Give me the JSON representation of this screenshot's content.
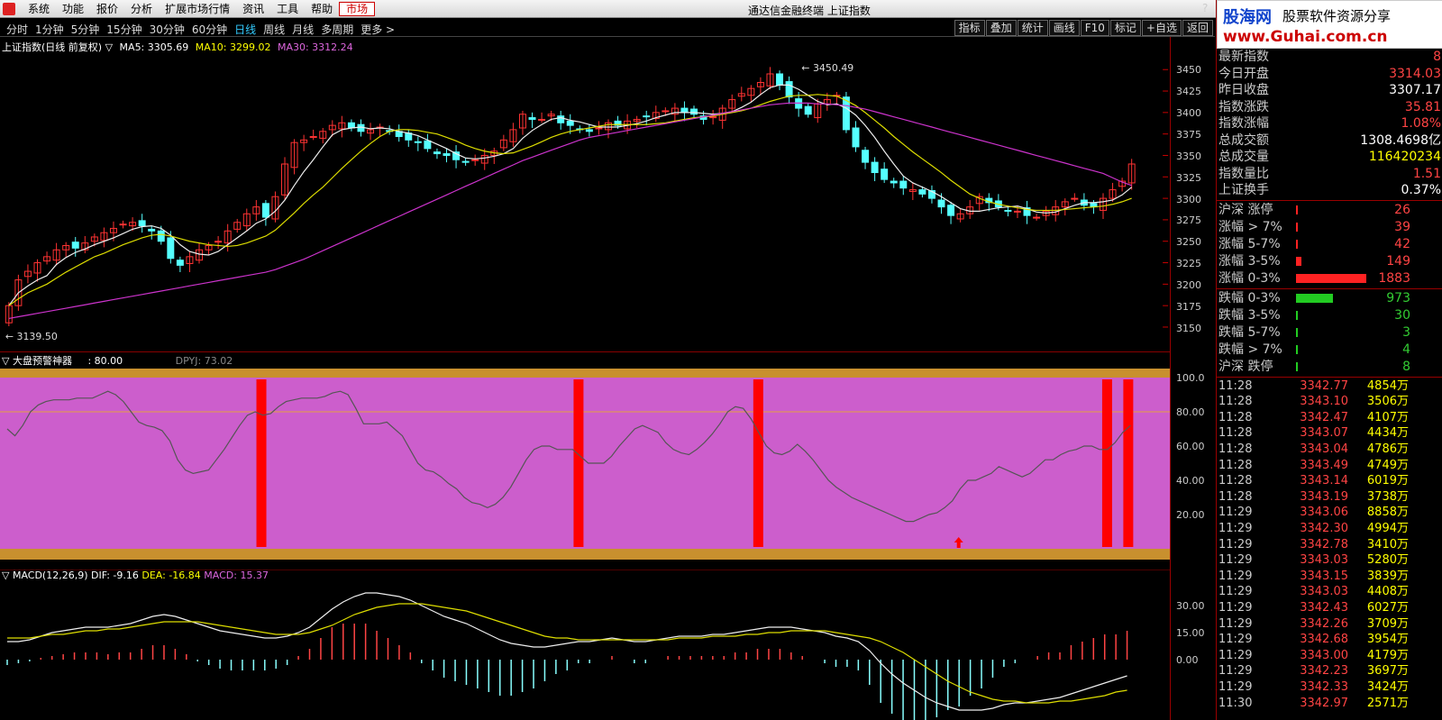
{
  "menu": {
    "items": [
      "系统",
      "功能",
      "报价",
      "分析",
      "扩展市场行情",
      "资讯",
      "工具",
      "帮助",
      "市场"
    ],
    "active_index": 8
  },
  "window_title": "通达信金融终端  上证指数",
  "periods": {
    "tabs": [
      "分时",
      "1分钟",
      "5分钟",
      "15分钟",
      "30分钟",
      "60分钟",
      "日线",
      "周线",
      "月线",
      "多周期",
      "更多 >"
    ],
    "selected_index": 6
  },
  "toolbar_right": [
    "指标",
    "叠加",
    "统计",
    "画线",
    "F10",
    "标记",
    "+自选",
    "返回"
  ],
  "help_label": "?",
  "legend": {
    "title": "上证指数(日线 前复权) ▽",
    "ma5": "MA5: 3305.69",
    "ma10": "MA10: 3299.02",
    "ma30": "MA30: 3312.24"
  },
  "price_annotations": {
    "high": "3450.49",
    "low": "3139.50"
  },
  "axis": {
    "price_ticks": [
      "3450",
      "3425",
      "3400",
      "3375",
      "3350",
      "3325",
      "3300",
      "3275",
      "3250",
      "3225",
      "3200",
      "3175",
      "3150"
    ],
    "ind_ticks": [
      "100.0",
      "80.00",
      "60.00",
      "40.00",
      "20.00"
    ],
    "macd_ticks": [
      "30.00",
      "15.00",
      "0.00"
    ]
  },
  "indicator": {
    "name": "▽ 大盘预警神器",
    "value": ": 80.00",
    "dpyj": "DPYJ: 73.02"
  },
  "macd": {
    "name": "▽ MACD(12,26,9)",
    "dif": "DIF: -9.16",
    "dea": "DEA: -16.84",
    "macd": "MACD: 15.37"
  },
  "logo": {
    "main": "股海网",
    "sub": "股票软件资源分享",
    "url": "www.Guhai.com.cn"
  },
  "quote": [
    {
      "k": "最新指数",
      "v": "8",
      "c": "red"
    },
    {
      "k": "今日开盘",
      "v": "3314.03",
      "c": "red"
    },
    {
      "k": "昨日收盘",
      "v": "3307.17",
      "c": "wht"
    },
    {
      "k": "指数涨跌",
      "v": "35.81",
      "c": "red"
    },
    {
      "k": "指数涨幅",
      "v": "1.08%",
      "c": "red"
    },
    {
      "k": "总成交额",
      "v": "1308.4698亿",
      "c": "wht"
    },
    {
      "k": "总成交量",
      "v": "116420234",
      "c": "yel"
    },
    {
      "k": "指数量比",
      "v": "1.51",
      "c": "red"
    },
    {
      "k": "上证换手",
      "v": "0.37%",
      "c": "wht"
    }
  ],
  "breadth_up": [
    {
      "k": "沪深  涨停",
      "v": "26",
      "frac": 0.0
    },
    {
      "k": "涨幅 > 7%",
      "v": "39",
      "frac": 0.0
    },
    {
      "k": "涨幅 5-7%",
      "v": "42",
      "frac": 0.0
    },
    {
      "k": "涨幅 3-5%",
      "v": "149",
      "frac": 0.08
    },
    {
      "k": "涨幅 0-3%",
      "v": "1883",
      "frac": 1.0
    }
  ],
  "breadth_down": [
    {
      "k": "跌幅 0-3%",
      "v": "973",
      "frac": 0.52
    },
    {
      "k": "跌幅 3-5%",
      "v": "30",
      "frac": 0.0
    },
    {
      "k": "跌幅 5-7%",
      "v": "3",
      "frac": 0.0
    },
    {
      "k": "跌幅 > 7%",
      "v": "4",
      "frac": 0.0
    },
    {
      "k": "沪深  跌停",
      "v": "8",
      "frac": 0.0
    }
  ],
  "ticks": [
    {
      "t": "11:28",
      "p": "3342.77",
      "q": "4854万"
    },
    {
      "t": "11:28",
      "p": "3343.10",
      "q": "3506万"
    },
    {
      "t": "11:28",
      "p": "3342.47",
      "q": "4107万"
    },
    {
      "t": "11:28",
      "p": "3343.07",
      "q": "4434万"
    },
    {
      "t": "11:28",
      "p": "3343.04",
      "q": "4786万"
    },
    {
      "t": "11:28",
      "p": "3343.49",
      "q": "4749万"
    },
    {
      "t": "11:28",
      "p": "3343.14",
      "q": "6019万"
    },
    {
      "t": "11:28",
      "p": "3343.19",
      "q": "3738万"
    },
    {
      "t": "11:29",
      "p": "3343.06",
      "q": "8858万"
    },
    {
      "t": "11:29",
      "p": "3342.30",
      "q": "4994万"
    },
    {
      "t": "11:29",
      "p": "3342.78",
      "q": "3410万"
    },
    {
      "t": "11:29",
      "p": "3343.03",
      "q": "5280万"
    },
    {
      "t": "11:29",
      "p": "3343.15",
      "q": "3839万"
    },
    {
      "t": "11:29",
      "p": "3343.03",
      "q": "4408万"
    },
    {
      "t": "11:29",
      "p": "3342.43",
      "q": "6027万"
    },
    {
      "t": "11:29",
      "p": "3342.26",
      "q": "3709万"
    },
    {
      "t": "11:29",
      "p": "3342.68",
      "q": "3954万"
    },
    {
      "t": "11:29",
      "p": "3343.00",
      "q": "4179万"
    },
    {
      "t": "11:29",
      "p": "3342.23",
      "q": "3697万"
    },
    {
      "t": "11:29",
      "p": "3342.33",
      "q": "3424万"
    },
    {
      "t": "11:30",
      "p": "3342.97",
      "q": "2571万"
    }
  ],
  "chart_data": [
    {
      "type": "candlestick",
      "title": "上证指数(日线 前复权)",
      "ylim": [
        3130,
        3465
      ],
      "close": [
        3175,
        3205,
        3215,
        3225,
        3232,
        3240,
        3245,
        3242,
        3248,
        3255,
        3260,
        3265,
        3270,
        3272,
        3268,
        3262,
        3250,
        3230,
        3222,
        3232,
        3240,
        3245,
        3250,
        3262,
        3272,
        3282,
        3290,
        3278,
        3302,
        3340,
        3365,
        3368,
        3372,
        3378,
        3385,
        3388,
        3382,
        3378,
        3380,
        3383,
        3378,
        3372,
        3368,
        3365,
        3358,
        3352,
        3350,
        3345,
        3342,
        3345,
        3350,
        3355,
        3368,
        3380,
        3398,
        3392,
        3392,
        3398,
        3388,
        3385,
        3380,
        3378,
        3382,
        3388,
        3385,
        3390,
        3392,
        3395,
        3400,
        3402,
        3405,
        3400,
        3398,
        3392,
        3395,
        3405,
        3415,
        3422,
        3428,
        3435,
        3445,
        3432,
        3418,
        3405,
        3398,
        3410,
        3415,
        3420,
        3380,
        3360,
        3342,
        3330,
        3322,
        3318,
        3312,
        3310,
        3305,
        3300,
        3290,
        3280,
        3282,
        3290,
        3302,
        3295,
        3290,
        3285,
        3285,
        3280,
        3278,
        3285,
        3290,
        3296,
        3300,
        3292,
        3290,
        3300,
        3310,
        3320,
        3340
      ],
      "ma5": [
        3175,
        3190,
        3198,
        3205,
        3210,
        3223,
        3231,
        3237,
        3241,
        3246,
        3250,
        3254,
        3259,
        3264,
        3267,
        3268,
        3265,
        3257,
        3246,
        3238,
        3235,
        3234,
        3238,
        3246,
        3254,
        3262,
        3271,
        3276,
        3285,
        3298,
        3315,
        3331,
        3345,
        3360,
        3374,
        3380,
        3382,
        3383,
        3381,
        3382,
        3381,
        3378,
        3376,
        3373,
        3368,
        3363,
        3358,
        3352,
        3347,
        3346,
        3347,
        3349,
        3352,
        3358,
        3370,
        3379,
        3386,
        3392,
        3394,
        3391,
        3389,
        3386,
        3383,
        3383,
        3383,
        3385,
        3387,
        3390,
        3394,
        3397,
        3400,
        3400,
        3400,
        3399,
        3398,
        3399,
        3401,
        3406,
        3412,
        3421,
        3429,
        3432,
        3432,
        3427,
        3420,
        3413,
        3409,
        3410,
        3405,
        3397,
        3385,
        3371,
        3355,
        3340,
        3326,
        3318,
        3313,
        3308,
        3302,
        3295,
        3288,
        3285,
        3285,
        3287,
        3289,
        3290,
        3291,
        3288,
        3284,
        3283,
        3284,
        3288,
        3292,
        3295,
        3295,
        3296,
        3298,
        3304,
        3313
      ],
      "ma10": [
        3175,
        3183,
        3190,
        3195,
        3200,
        3207,
        3214,
        3220,
        3226,
        3232,
        3236,
        3241,
        3246,
        3250,
        3254,
        3257,
        3258,
        3256,
        3253,
        3250,
        3248,
        3246,
        3245,
        3244,
        3245,
        3248,
        3252,
        3256,
        3263,
        3273,
        3283,
        3294,
        3304,
        3313,
        3324,
        3335,
        3345,
        3355,
        3364,
        3372,
        3378,
        3380,
        3380,
        3379,
        3377,
        3375,
        3371,
        3367,
        3362,
        3358,
        3355,
        3353,
        3352,
        3353,
        3357,
        3361,
        3366,
        3371,
        3375,
        3378,
        3380,
        3382,
        3384,
        3386,
        3386,
        3386,
        3386,
        3386,
        3387,
        3388,
        3390,
        3392,
        3394,
        3395,
        3396,
        3398,
        3400,
        3402,
        3405,
        3409,
        3413,
        3416,
        3419,
        3420,
        3420,
        3421,
        3420,
        3419,
        3414,
        3408,
        3400,
        3391,
        3382,
        3372,
        3363,
        3354,
        3346,
        3338,
        3330,
        3321,
        3313,
        3305,
        3300,
        3296,
        3293,
        3291,
        3289,
        3287,
        3286,
        3286,
        3286,
        3287,
        3288,
        3289,
        3290,
        3291,
        3293,
        3296,
        3300
      ],
      "ma30": [
        3160,
        3162,
        3164,
        3166,
        3168,
        3170,
        3172,
        3174,
        3176,
        3178,
        3180,
        3182,
        3184,
        3186,
        3188,
        3190,
        3192,
        3194,
        3196,
        3198,
        3200,
        3202,
        3204,
        3206,
        3208,
        3210,
        3212,
        3214,
        3217,
        3221,
        3225,
        3229,
        3234,
        3239,
        3244,
        3249,
        3254,
        3259,
        3264,
        3269,
        3274,
        3279,
        3284,
        3289,
        3294,
        3299,
        3304,
        3309,
        3314,
        3319,
        3324,
        3329,
        3334,
        3339,
        3344,
        3348,
        3352,
        3356,
        3360,
        3364,
        3368,
        3371,
        3373,
        3375,
        3377,
        3379,
        3381,
        3383,
        3385,
        3387,
        3389,
        3391,
        3393,
        3395,
        3397,
        3399,
        3401,
        3403,
        3405,
        3407,
        3409,
        3410,
        3411,
        3411,
        3411,
        3410,
        3410,
        3409,
        3408,
        3406,
        3404,
        3401,
        3398,
        3395,
        3392,
        3389,
        3386,
        3383,
        3380,
        3377,
        3374,
        3371,
        3368,
        3365,
        3362,
        3359,
        3356,
        3353,
        3350,
        3347,
        3344,
        3341,
        3338,
        3335,
        3332,
        3329,
        3324,
        3319,
        3315
      ]
    },
    {
      "type": "line",
      "title": "大盘预警神器",
      "ylim": [
        0,
        100
      ],
      "threshold": 80,
      "values": [
        70,
        66,
        72,
        80,
        84,
        86,
        87,
        87,
        87,
        88,
        88,
        88,
        90,
        92,
        90,
        86,
        80,
        74,
        72,
        71,
        69,
        63,
        52,
        46,
        44,
        45,
        46,
        52,
        58,
        65,
        72,
        78,
        80,
        78,
        79,
        83,
        86,
        87,
        88,
        88,
        88,
        89,
        91,
        92,
        90,
        82,
        73,
        73,
        73,
        74,
        70,
        66,
        58,
        50,
        46,
        45,
        42,
        38,
        35,
        30,
        27,
        26,
        24,
        26,
        30,
        36,
        44,
        52,
        58,
        60,
        60,
        58,
        58,
        58,
        54,
        50,
        50,
        50,
        54,
        60,
        65,
        70,
        72,
        70,
        68,
        62,
        58,
        56,
        55,
        58,
        62,
        67,
        73,
        80,
        83,
        82,
        76,
        68,
        60,
        56,
        55,
        57,
        61,
        57,
        52,
        46,
        40,
        36,
        33,
        30,
        28,
        26,
        24,
        22,
        20,
        18,
        16,
        16,
        18,
        20,
        21,
        24,
        28,
        35,
        40,
        40,
        42,
        44,
        48,
        46,
        44,
        42,
        44,
        48,
        52,
        52,
        55,
        57,
        58,
        60,
        60,
        58,
        58,
        62,
        68,
        72
      ],
      "signals": [
        24,
        54,
        71,
        104,
        106
      ],
      "arrow_at": 90
    },
    {
      "type": "macd",
      "title": "MACD(12,26,9)",
      "ylim": [
        -30,
        40
      ],
      "dif": [
        10,
        10,
        11,
        13,
        15,
        16,
        17,
        18,
        18,
        18,
        19,
        20,
        22,
        24,
        25,
        24,
        22,
        20,
        18,
        16,
        15,
        14,
        13,
        12,
        12,
        13,
        15,
        18,
        23,
        28,
        32,
        35,
        37,
        37,
        36,
        35,
        33,
        30,
        27,
        24,
        22,
        20,
        17,
        14,
        11,
        9,
        8,
        7,
        7,
        8,
        9,
        10,
        10,
        11,
        12,
        11,
        10,
        10,
        11,
        12,
        13,
        13,
        13,
        14,
        14,
        15,
        16,
        17,
        18,
        18,
        18,
        17,
        16,
        15,
        13,
        12,
        10,
        5,
        -2,
        -8,
        -13,
        -17,
        -21,
        -24,
        -26,
        -28,
        -28,
        -28,
        -27,
        -25,
        -24,
        -24,
        -23,
        -22,
        -21,
        -19,
        -17,
        -15,
        -13,
        -11,
        -9
      ],
      "dea": [
        12,
        12,
        12,
        13,
        14,
        14,
        15,
        16,
        16,
        17,
        17,
        18,
        19,
        20,
        21,
        21,
        21,
        21,
        20,
        19,
        18,
        17,
        16,
        15,
        14,
        14,
        14,
        15,
        17,
        19,
        22,
        25,
        27,
        29,
        30,
        31,
        31,
        31,
        30,
        29,
        28,
        27,
        25,
        23,
        21,
        19,
        17,
        15,
        13,
        12,
        12,
        11,
        11,
        11,
        11,
        11,
        11,
        11,
        11,
        11,
        12,
        12,
        12,
        13,
        13,
        13,
        14,
        14,
        15,
        15,
        16,
        16,
        16,
        16,
        15,
        14,
        13,
        12,
        10,
        7,
        4,
        0,
        -4,
        -8,
        -12,
        -15,
        -18,
        -20,
        -22,
        -23,
        -23,
        -24,
        -24,
        -24,
        -23,
        -23,
        -22,
        -21,
        -20,
        -18,
        -17
      ],
      "hist": [
        -3,
        -2,
        -1,
        1,
        2,
        3,
        4,
        4,
        4,
        3,
        4,
        4,
        6,
        8,
        8,
        6,
        3,
        -1,
        -3,
        -5,
        -6,
        -6,
        -6,
        -6,
        -5,
        -3,
        2,
        6,
        12,
        18,
        20,
        20,
        20,
        16,
        12,
        8,
        4,
        -2,
        -6,
        -10,
        -12,
        -14,
        -16,
        -18,
        -20,
        -20,
        -18,
        -16,
        -12,
        -8,
        -6,
        -2,
        -2,
        0,
        2,
        0,
        -2,
        -2,
        0,
        2,
        2,
        2,
        2,
        2,
        2,
        4,
        4,
        6,
        6,
        6,
        4,
        2,
        0,
        -2,
        -4,
        -4,
        -6,
        -14,
        -24,
        -30,
        -34,
        -34,
        -34,
        -32,
        -28,
        -26,
        -20,
        -16,
        -10,
        -4,
        -2,
        0,
        2,
        4,
        4,
        8,
        10,
        12,
        14,
        14,
        16
      ]
    }
  ]
}
